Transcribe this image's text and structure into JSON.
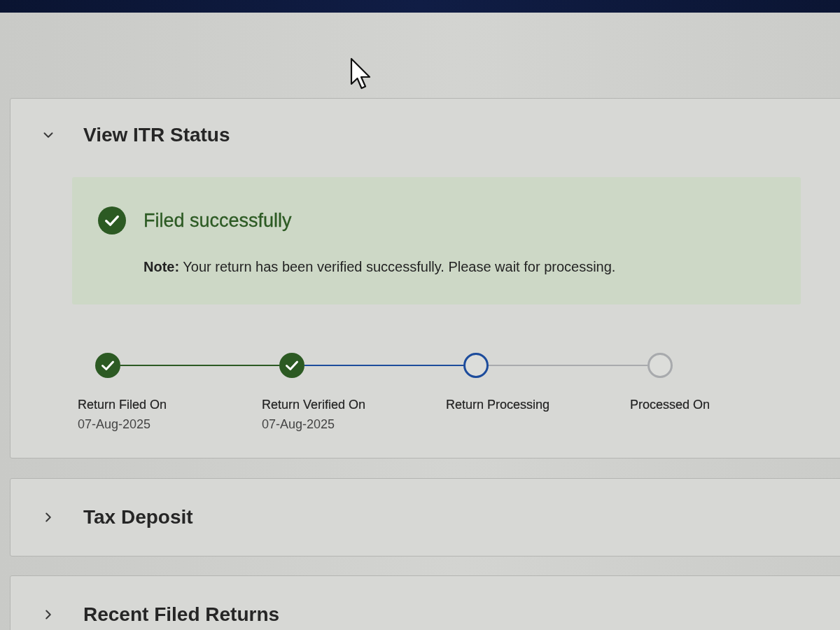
{
  "sections": [
    {
      "title": "View ITR Status",
      "expanded": true,
      "banner": {
        "heading": "Filed successfully",
        "note": "**Note:** Your return has been verified successfully. Please wait for processing."
      },
      "steps": [
        {
          "label": "Return Filed On",
          "date": "07-Aug-2025",
          "done": true,
          "current": false
        },
        {
          "label": "Return Verified On",
          "date": "07-Aug-2025",
          "done": true,
          "current": false
        },
        {
          "label": "Return Processing",
          "done": false,
          "current": true
        },
        {
          "label": "Processed On",
          "done": false,
          "current": false
        }
      ]
    },
    {
      "title": "Tax Deposit",
      "expanded": false
    },
    {
      "title": "Recent Filed Returns",
      "expanded": false
    }
  ]
}
